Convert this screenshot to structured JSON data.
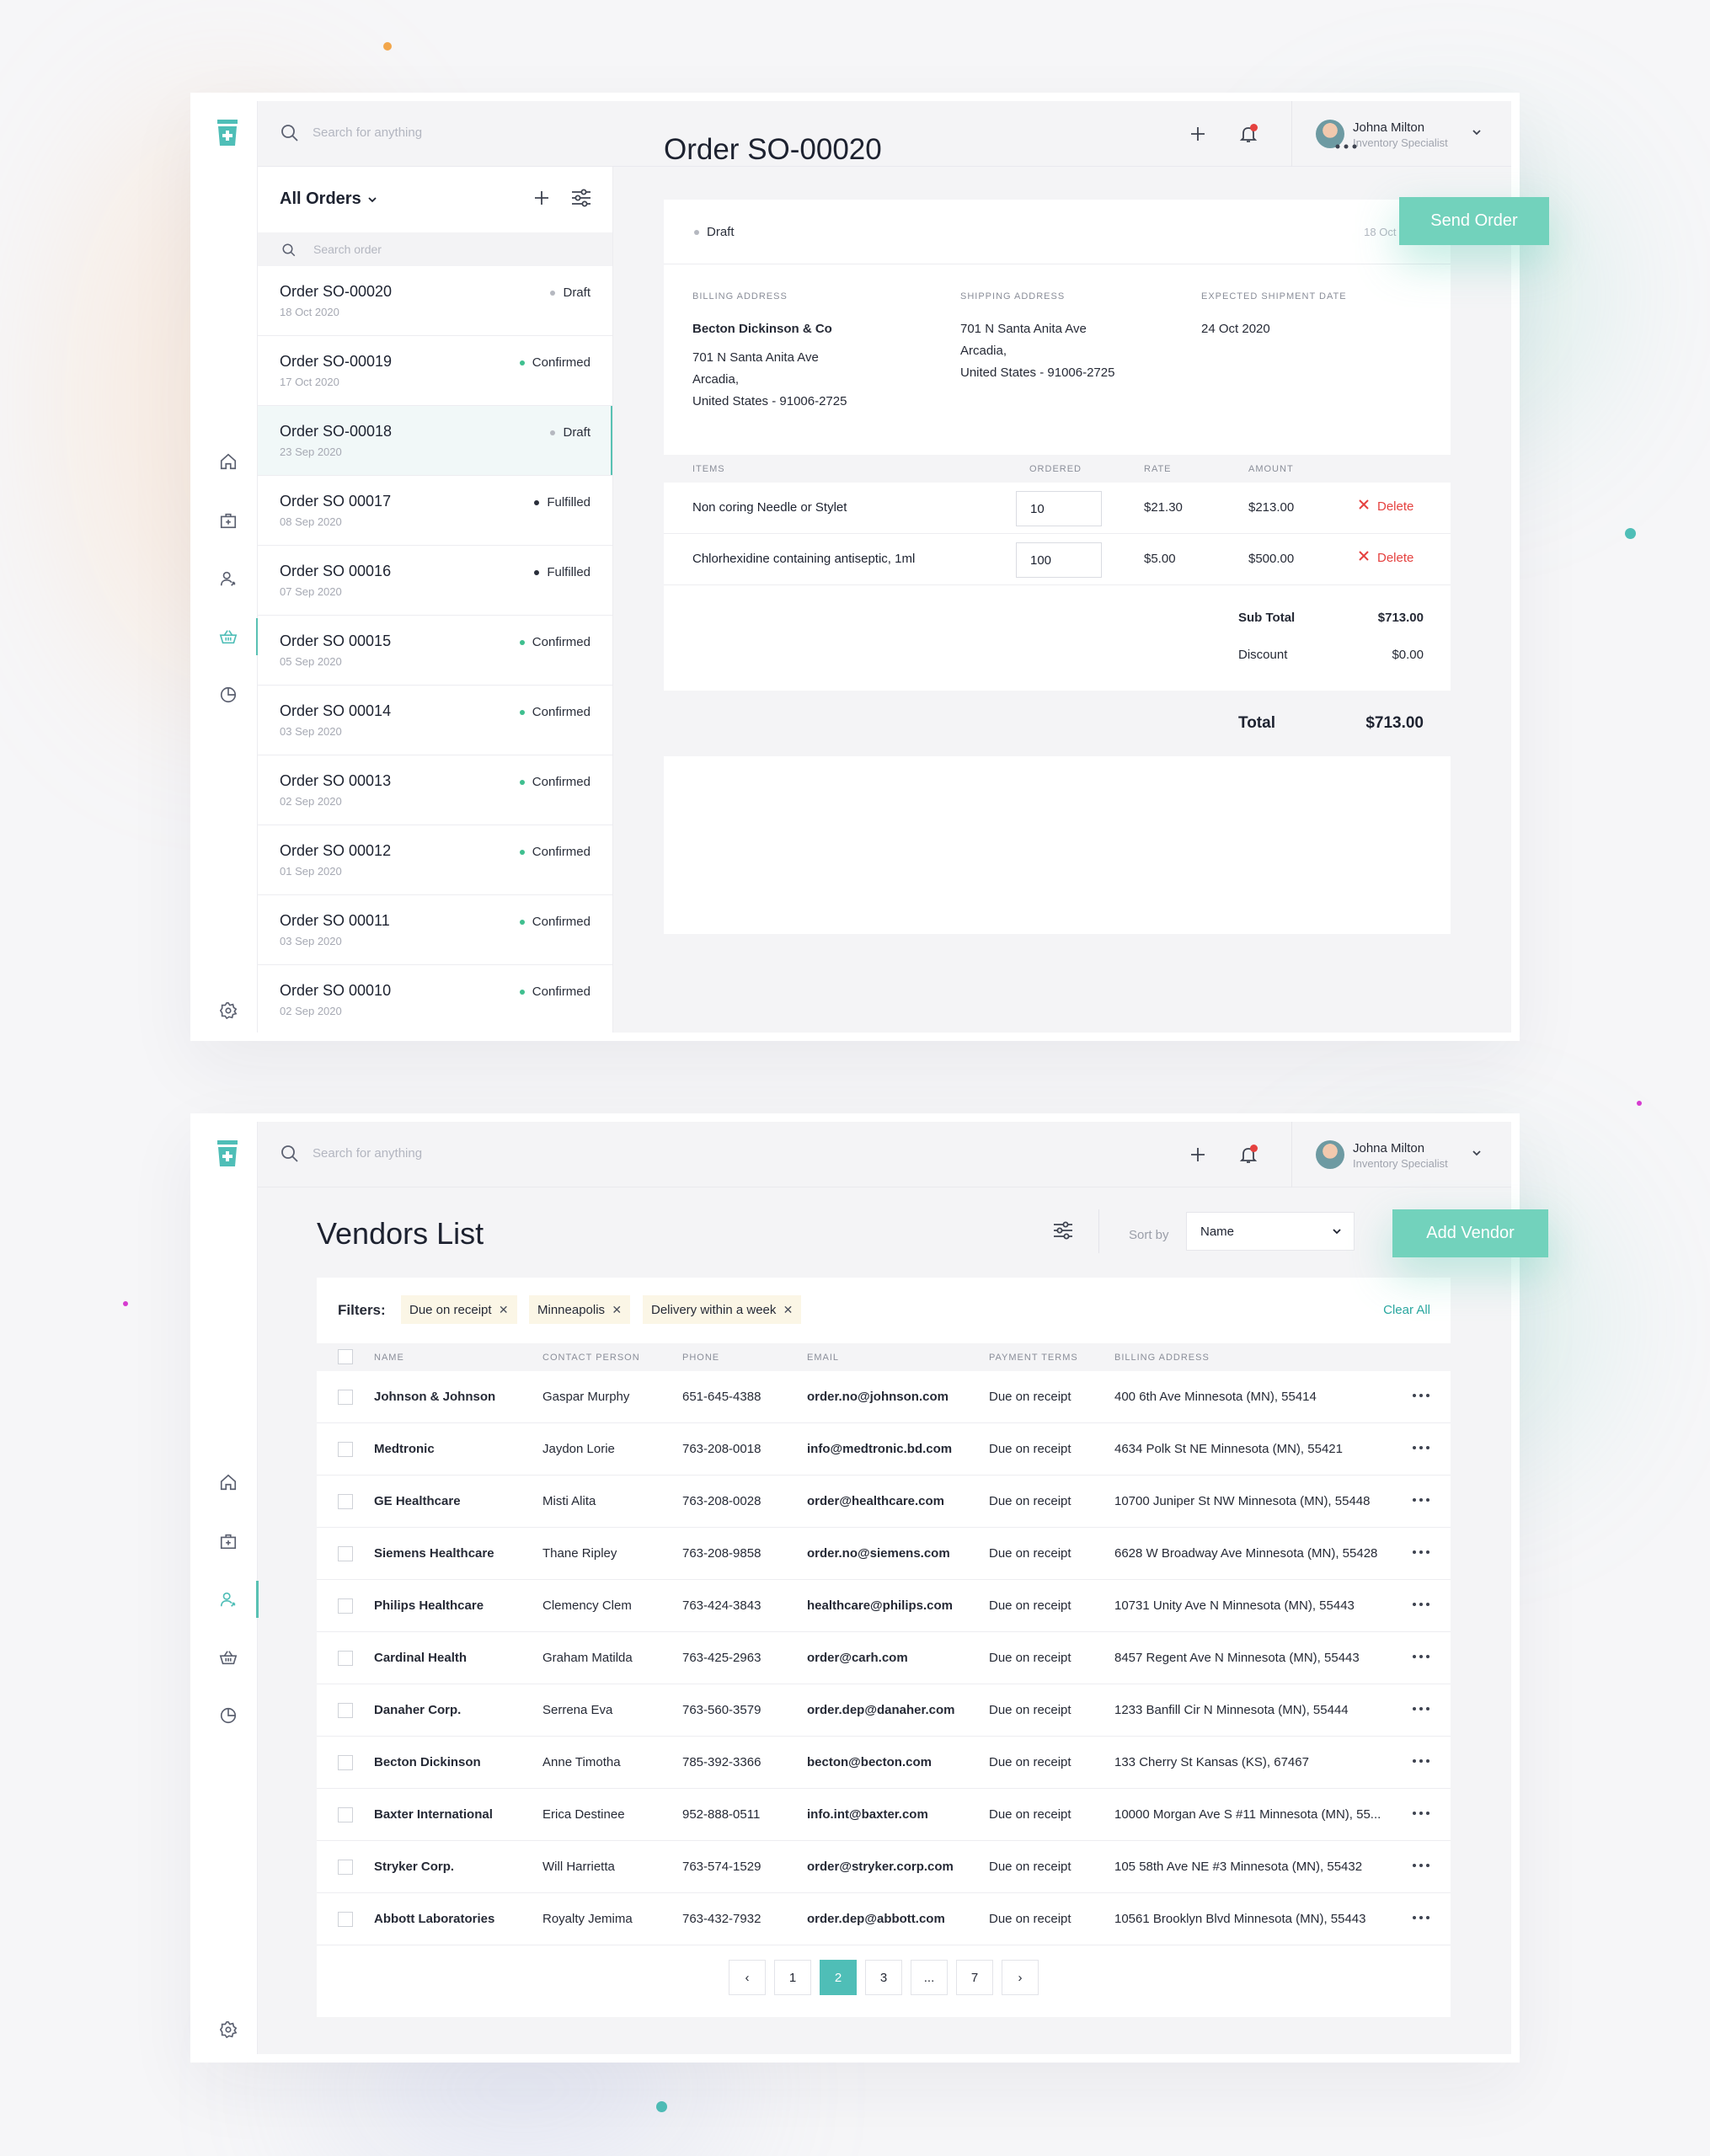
{
  "user": {
    "name": "Johna Milton",
    "role": "Inventory Specialist"
  },
  "search": {
    "placeholder": "Search for anything"
  },
  "orders_panel": {
    "title": "All Orders",
    "search_placeholder": "Search order",
    "orders": [
      {
        "name": "Order SO-00020",
        "date": "18 Oct 2020",
        "status": "Draft",
        "status_color": "#b5b8c0"
      },
      {
        "name": "Order SO-00019",
        "date": "17 Oct 2020",
        "status": "Confirmed",
        "status_color": "#3fbf8f"
      },
      {
        "name": "Order SO-00018",
        "date": "23 Sep 2020",
        "status": "Draft",
        "status_color": "#b5b8c0",
        "selected": true
      },
      {
        "name": "Order SO 00017",
        "date": "08 Sep 2020",
        "status": "Fulfilled",
        "status_color": "#2a2f3b"
      },
      {
        "name": "Order SO 00016",
        "date": "07 Sep 2020",
        "status": "Fulfilled",
        "status_color": "#2a2f3b"
      },
      {
        "name": "Order SO 00015",
        "date": "05 Sep 2020",
        "status": "Confirmed",
        "status_color": "#3fbf8f"
      },
      {
        "name": "Order SO 00014",
        "date": "03 Sep 2020",
        "status": "Confirmed",
        "status_color": "#3fbf8f"
      },
      {
        "name": "Order SO 00013",
        "date": "02 Sep 2020",
        "status": "Confirmed",
        "status_color": "#3fbf8f"
      },
      {
        "name": "Order SO 00012",
        "date": "01 Sep 2020",
        "status": "Confirmed",
        "status_color": "#3fbf8f"
      },
      {
        "name": "Order SO 00011",
        "date": "03 Sep 2020",
        "status": "Confirmed",
        "status_color": "#3fbf8f"
      },
      {
        "name": "Order SO 00010",
        "date": "02 Sep 2020",
        "status": "Confirmed",
        "status_color": "#3fbf8f"
      }
    ]
  },
  "order_detail": {
    "title": "Order SO-00020",
    "send_label": "Send Order",
    "status": "Draft",
    "date": "18 Oct 2020",
    "billing_label": "BILLING ADDRESS",
    "shipping_label": "SHIPPING ADDRESS",
    "expected_label": "EXPECTED SHIPMENT DATE",
    "billing": {
      "company": "Becton Dickinson & Co",
      "line1": "701 N Santa Anita Ave",
      "line2": "Arcadia,",
      "line3": "United States - 91006-2725"
    },
    "shipping": {
      "line1": "701 N Santa Anita Ave",
      "line2": "Arcadia,",
      "line3": "United States - 91006-2725"
    },
    "expected_date": "24 Oct 2020",
    "columns": {
      "items": "ITEMS",
      "ordered": "ORDERED",
      "rate": "RATE",
      "amount": "AMOUNT"
    },
    "items": [
      {
        "name": "Non coring Needle or Stylet",
        "qty": "10",
        "rate": "$21.30",
        "amount": "$213.00",
        "action": "Delete"
      },
      {
        "name": "Chlorhexidine containing antiseptic, 1ml",
        "qty": "100",
        "rate": "$5.00",
        "amount": "$500.00",
        "action": "Delete"
      }
    ],
    "subtotal_label": "Sub Total",
    "subtotal": "$713.00",
    "discount_label": "Discount",
    "discount": "$0.00",
    "total_label": "Total",
    "total": "$713.00"
  },
  "vendors": {
    "title": "Vendors List",
    "sort_label": "Sort by",
    "sort_value": "Name",
    "add_label": "Add Vendor",
    "filters_label": "Filters:",
    "filters": [
      "Due on receipt",
      "Minneapolis",
      "Delivery within a week"
    ],
    "clear_label": "Clear All",
    "columns": {
      "name": "NAME",
      "contact": "CONTACT PERSON",
      "phone": "PHONE",
      "email": "EMAIL",
      "terms": "PAYMENT TERMS",
      "address": "BILLING ADDRESS"
    },
    "rows": [
      {
        "name": "Johnson & Johnson",
        "contact": "Gaspar Murphy",
        "phone": "651-645-4388",
        "email": "order.no@johnson.com",
        "terms": "Due on receipt",
        "address": "400 6th Ave Minnesota (MN), 55414"
      },
      {
        "name": "Medtronic",
        "contact": "Jaydon Lorie",
        "phone": "763-208-0018",
        "email": "info@medtronic.bd.com",
        "terms": "Due on receipt",
        "address": "4634 Polk St NE Minnesota (MN), 55421"
      },
      {
        "name": "GE Healthcare",
        "contact": "Misti Alita",
        "phone": "763-208-0028",
        "email": "order@healthcare.com",
        "terms": "Due on receipt",
        "address": "10700 Juniper St NW Minnesota (MN), 55448"
      },
      {
        "name": "Siemens Healthcare",
        "contact": "Thane Ripley",
        "phone": "763-208-9858",
        "email": "order.no@siemens.com",
        "terms": "Due on receipt",
        "address": "6628 W Broadway Ave Minnesota (MN), 55428"
      },
      {
        "name": "Philips Healthcare",
        "contact": "Clemency Clem",
        "phone": "763-424-3843",
        "email": "healthcare@philips.com",
        "terms": "Due on receipt",
        "address": "10731 Unity Ave N Minnesota (MN), 55443"
      },
      {
        "name": "Cardinal Health",
        "contact": "Graham Matilda",
        "phone": "763-425-2963",
        "email": "order@carh.com",
        "terms": "Due on receipt",
        "address": "8457 Regent Ave N Minnesota (MN), 55443"
      },
      {
        "name": "Danaher Corp.",
        "contact": "Serrena Eva",
        "phone": "763-560-3579",
        "email": "order.dep@danaher.com",
        "terms": "Due on receipt",
        "address": "1233 Banfill Cir N Minnesota (MN), 55444"
      },
      {
        "name": "Becton Dickinson",
        "contact": "Anne Timotha",
        "phone": "785-392-3366",
        "email": "becton@becton.com",
        "terms": "Due on receipt",
        "address": "133 Cherry St Kansas (KS), 67467"
      },
      {
        "name": "Baxter International",
        "contact": "Erica Destinee",
        "phone": "952-888-0511",
        "email": "info.int@baxter.com",
        "terms": "Due on receipt",
        "address": "10000 Morgan Ave S #11 Minnesota (MN), 55..."
      },
      {
        "name": "Stryker Corp.",
        "contact": "Will Harrietta",
        "phone": "763-574-1529",
        "email": "order@stryker.corp.com",
        "terms": "Due on receipt",
        "address": "105 58th Ave NE #3 Minnesota (MN), 55432"
      },
      {
        "name": "Abbott Laboratories",
        "contact": "Royalty Jemima",
        "phone": "763-432-7932",
        "email": "order.dep@abbott.com",
        "terms": "Due on receipt",
        "address": "10561 Brooklyn Blvd Minnesota (MN), 55443"
      }
    ],
    "pagination": {
      "prev": "‹",
      "pages": [
        "1",
        "2",
        "3",
        "...",
        "7"
      ],
      "current": "2",
      "next": "›"
    }
  }
}
